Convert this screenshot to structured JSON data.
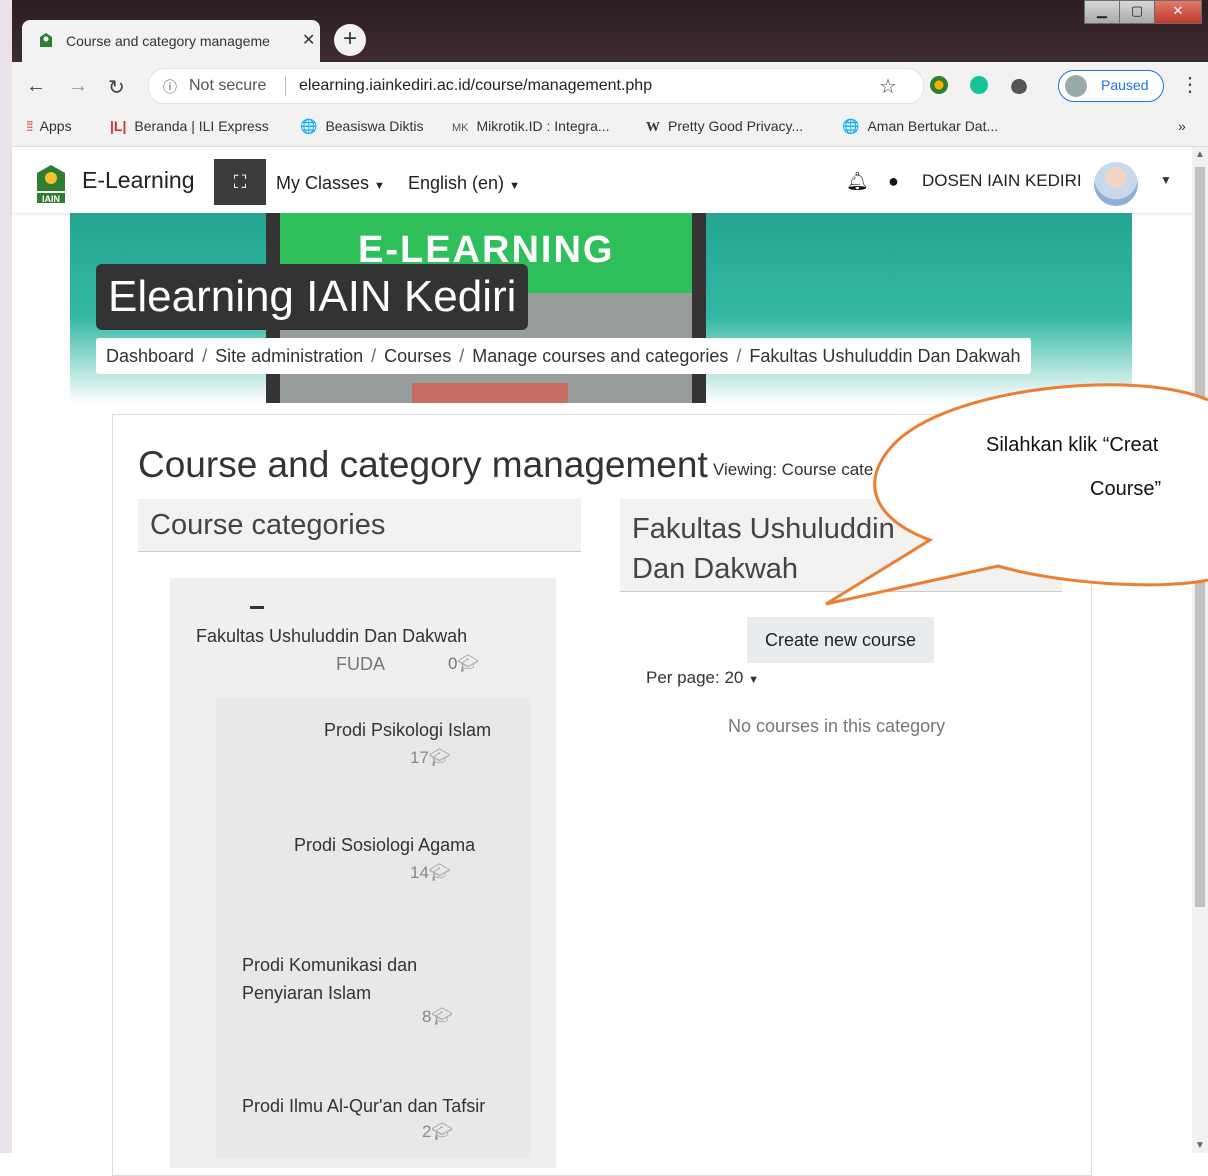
{
  "browser": {
    "tab_title": "Course and category manageme",
    "tab_close": "✕",
    "new_tab": "+",
    "window_min": "▁",
    "window_max": "▢",
    "window_close": "✕",
    "security_text": "Not secure",
    "url": "elearning.iainkediri.ac.id/course/management.php",
    "profile_status": "Paused",
    "bookmarks": [
      {
        "label": "Apps",
        "icon": "apps-grid-icon"
      },
      {
        "label": "Beranda | ILI Express",
        "icon": "ili-logo-icon"
      },
      {
        "label": "Beasiswa Diktis",
        "icon": "globe-icon"
      },
      {
        "label": "Mikrotik.ID : Integra...",
        "icon": "mikrotik-icon"
      },
      {
        "label": "Pretty Good Privacy...",
        "icon": "wikipedia-icon"
      },
      {
        "label": "Aman Bertukar Dat...",
        "icon": "globe-icon"
      }
    ],
    "bookmarks_more": "»"
  },
  "navbar": {
    "brand": "E-Learning",
    "my_classes": "My Classes",
    "language": "English (en)",
    "user_name": "DOSEN IAIN KEDIRI"
  },
  "header": {
    "banner_label": "E-LEARNING",
    "site_title": "Elearning IAIN Kediri",
    "breadcrumb": [
      "Dashboard",
      "Site administration",
      "Courses",
      "Manage courses and categories",
      "Fakultas Ushuluddin Dan Dakwah"
    ],
    "breadcrumb_divider": "/"
  },
  "main": {
    "page_title": "Course and category management",
    "viewing": "Viewing: Course cate",
    "categories_heading": "Course categories",
    "faculty_heading": "Fakultas Ushuluddin Dan Dakwah",
    "faculty": {
      "name": "Fakultas Ushuluddin Dan Dakwah",
      "code": "FUDA",
      "count": "0"
    },
    "subcategories": [
      {
        "name": "Prodi Psikologi Islam",
        "count": "17"
      },
      {
        "name": "Prodi Sosiologi Agama",
        "count": "14"
      },
      {
        "name": "Prodi Komunikasi dan Penyiaran Islam",
        "count": "8"
      },
      {
        "name": "Prodi Ilmu Al-Qur'an dan Tafsir",
        "count": "2"
      }
    ],
    "create_button": "Create new course",
    "per_page": "Per page: 20",
    "empty_message": "No courses in this category"
  },
  "callout": {
    "line1": "Silahkan klik “Creat",
    "line2": "Course”",
    "border_color": "#ED7D31"
  },
  "colors": {
    "banner_teal": "#24a592",
    "navbar_dark": "#3b3b3b",
    "profile_blue": "#1a73e8"
  }
}
